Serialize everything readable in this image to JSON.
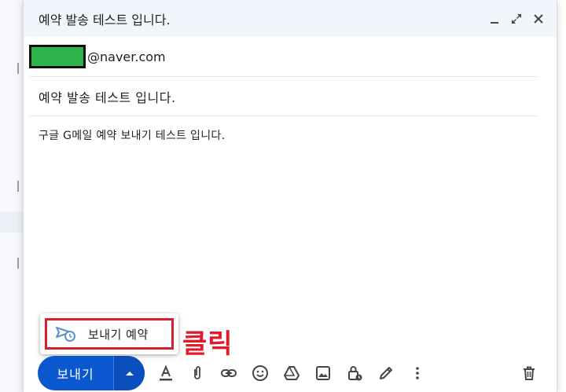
{
  "compose": {
    "title": "예약 발송 테스트 입니다.",
    "to_suffix": "@naver.com",
    "subject": "예약 발송 테스트 입니다.",
    "body": "구글 G메일 예약 보내기 테스트 입니다."
  },
  "popup": {
    "schedule_label": "보내기 예약"
  },
  "annotation": {
    "click_text": "클릭"
  },
  "toolbar": {
    "send_label": "보내기",
    "icons": [
      "format-text-icon",
      "attach-icon",
      "link-icon",
      "emoji-icon",
      "drive-icon",
      "photo-icon",
      "confidential-lock-icon",
      "signature-pen-icon",
      "more-options-icon",
      "trash-icon"
    ]
  },
  "colors": {
    "send_blue": "#0b57d0",
    "highlight_red": "#d9202e",
    "redaction_green": "#2db34a"
  }
}
